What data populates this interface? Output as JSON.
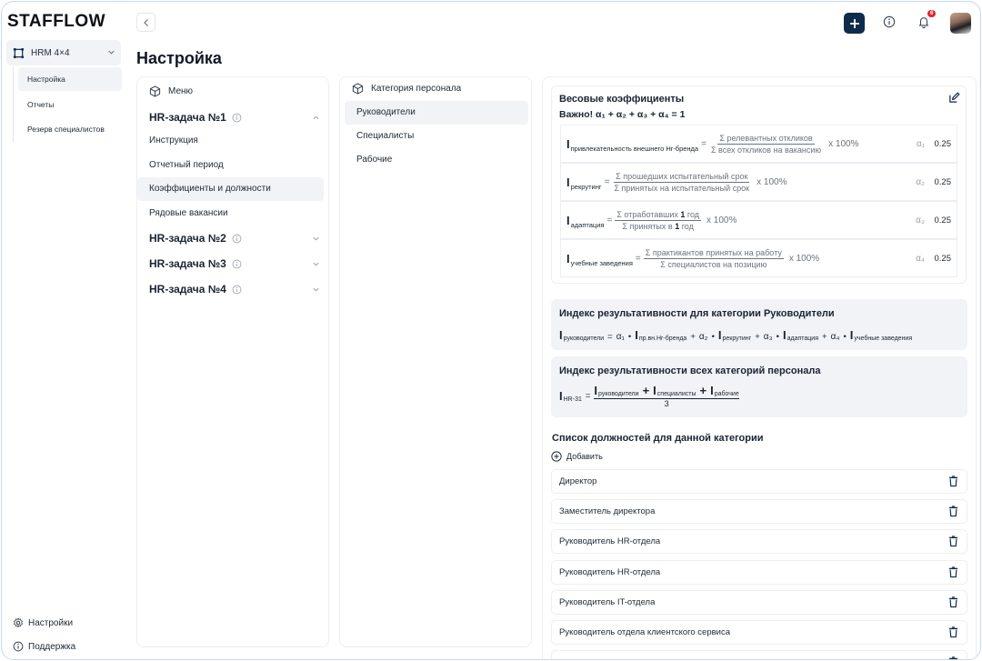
{
  "app": {
    "logo": "STAFFLOW"
  },
  "sidebar": {
    "project": "HRM 4×4",
    "items": [
      {
        "label": "Настройка",
        "active": true
      },
      {
        "label": "Отчеты",
        "active": false
      },
      {
        "label": "Резерв специалистов",
        "active": false
      }
    ],
    "settings": "Настройки",
    "support": "Поддержка"
  },
  "header": {
    "notifications_count": "6"
  },
  "page": {
    "title": "Настройка"
  },
  "menu_panel": {
    "title": "Меню",
    "task1": "HR-задача №1",
    "task1_items": [
      "Инструкция",
      "Отчетный период",
      "Коэффициенты и должности",
      "Рядовые вакансии"
    ],
    "task2": "HR-задача №2",
    "task3": "HR-задача №3",
    "task4": "HR-задача №4"
  },
  "category_panel": {
    "title": "Категория персонала",
    "items": [
      "Руководители",
      "Специалисты",
      "Рабочие"
    ]
  },
  "weights": {
    "title": "Весовые коэффициенты",
    "important": "Важно! α₁ + α₂ + α₃ + α₄ = 1",
    "rows": [
      {
        "sub": "привлекательность внешнего Hr-бренда",
        "num": "Σ релевантных откликов",
        "den": "Σ всех откликов на вакансию",
        "pct": "х 100%",
        "alpha": "α₁",
        "value": "0.25"
      },
      {
        "sub": "рекрутинг",
        "num": "Σ прошедших испытательный срок",
        "den": "Σ принятых на испытательный срок",
        "pct": "х 100%",
        "alpha": "α₂",
        "value": "0.25"
      },
      {
        "sub": "адаптация",
        "num_pre": "Σ отработавших ",
        "num_bold": "1",
        "num_post": " год",
        "den_pre": "Σ принятых в ",
        "den_bold": "1",
        "den_post": " год",
        "pct": "х 100%",
        "alpha": "α₃",
        "value": "0.25"
      },
      {
        "sub": "учебные заведения",
        "num": "Σ практикантов принятых на работу",
        "den": "Σ специалистов на позицию",
        "pct": "х 100%",
        "alpha": "α₄",
        "value": "0.25"
      }
    ]
  },
  "index_managers": {
    "title": "Индекс результативности для категории Руководители",
    "lhs_sub": "руководители",
    "eq": "=",
    "t1_alpha": "α₁",
    "t1_sub": "пр.вн.Hr-бренда",
    "t2_alpha": "α₂",
    "t2_sub": "рекрутинг",
    "t3_alpha": "α₃",
    "t3_sub": "адаптация",
    "t4_alpha": "α₄",
    "t4_sub": "учебные заведения"
  },
  "index_all": {
    "title": "Индекс результативности всех категорий персонала",
    "lhs_sub": "HR-31",
    "n1": "руководители",
    "n2": "специалисты",
    "n3": "рабочие",
    "den": "3"
  },
  "positions": {
    "title": "Список должностей для данной категории",
    "add": "Добавить",
    "items": [
      "Директор",
      "Заместитель директора",
      "Руководитель HR-отдела",
      "Руководитель HR-отдела",
      "Руководитель IT-отдела",
      "Руководитель отдела клиентского сервиса"
    ]
  }
}
